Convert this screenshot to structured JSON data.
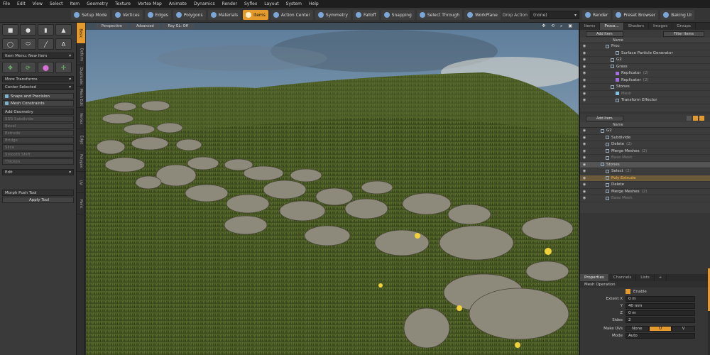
{
  "menu": [
    "File",
    "Edit",
    "View",
    "Select",
    "Item",
    "Geometry",
    "Texture",
    "Vertex Map",
    "Animate",
    "Dynamics",
    "Render",
    "Syflex",
    "Layout",
    "System",
    "Help"
  ],
  "modebar": {
    "buttons": [
      {
        "label": "Setup Mode",
        "icon": "setup-icon"
      },
      {
        "label": "Vertices",
        "icon": "vertices-icon"
      },
      {
        "label": "Edges",
        "icon": "edges-icon"
      },
      {
        "label": "Polygons",
        "icon": "polygons-icon"
      },
      {
        "label": "Materials",
        "icon": "materials-icon"
      },
      {
        "label": "Items",
        "icon": "items-icon",
        "active": true
      },
      {
        "label": "Action Center",
        "icon": "action-center-icon"
      },
      {
        "label": "Symmetry",
        "icon": "symmetry-icon"
      },
      {
        "label": "Falloff",
        "icon": "falloff-icon"
      },
      {
        "label": "Snapping",
        "icon": "snapping-icon"
      },
      {
        "label": "Select Through",
        "icon": "select-through-icon"
      },
      {
        "label": "WorkPlane",
        "icon": "workplane-icon"
      }
    ],
    "drop_action_label": "Drop Action",
    "drop_action_value": "(none)",
    "render_label": "Render",
    "preset_browser_label": "Preset Browser",
    "baking_label": "Baking UI"
  },
  "left": {
    "item_menu": "Item Menu: New Item",
    "more_transforms": "More Transforms",
    "center_selected": "Center Selected",
    "snaps": "Snaps and Precision",
    "mesh_constraints": "Mesh Constraints",
    "add_geometry": "Add Geometry",
    "geo_tools": [
      "SDS Subdivide",
      "Bevel",
      "Extrude",
      "Bridge",
      "Slice",
      "Smooth Shift",
      "Thicken"
    ],
    "edit_drop": "Edit",
    "morph_push": "Morph Push Tool",
    "apply_tool": "Apply Tool"
  },
  "side_tabs": [
    "Basic",
    "Deform",
    "Duplicate",
    "Mesh Edit",
    "Vertex",
    "Edge",
    "Polygon",
    "UV",
    "Paint"
  ],
  "viewport": {
    "tabs": [
      "Perspective",
      "Advanced",
      "Ray GL: Off"
    ],
    "tools": "✥ ⟲ ⌕ ▣"
  },
  "right": {
    "top_tabs": [
      "Items",
      "Proce...",
      "Shaders",
      "Images",
      "Groups"
    ],
    "add_item": "Add Item",
    "filter_items": "Filter Items",
    "name_header": "Name",
    "scene_items": [
      {
        "name": "Proc",
        "type": "folder",
        "indent": 2
      },
      {
        "name": "Surface Particle Generator",
        "type": "gen",
        "indent": 4
      },
      {
        "name": "G2",
        "type": "chk",
        "indent": 3
      },
      {
        "name": "Grass",
        "type": "chk",
        "indent": 3
      },
      {
        "name": "Replicator",
        "type": "rep",
        "count": "(2)",
        "indent": 4
      },
      {
        "name": "Replicator",
        "type": "rep",
        "count": "(2)",
        "indent": 4
      },
      {
        "name": "Stones",
        "type": "chk",
        "indent": 3
      },
      {
        "name": "Mesh",
        "type": "mesh",
        "indent": 4,
        "dim": true
      },
      {
        "name": "Transform Effector",
        "type": "gen",
        "indent": 4
      }
    ],
    "proc_add_item": "Add Item",
    "proc_items": [
      {
        "name": "G2",
        "indent": 1
      },
      {
        "name": "Subdivide",
        "indent": 2
      },
      {
        "name": "Delete",
        "count": "(2)",
        "indent": 2
      },
      {
        "name": "Merge Meshes",
        "count": "(2)",
        "indent": 2
      },
      {
        "name": "Base Mesh",
        "indent": 2,
        "dim": true
      },
      {
        "name": "Stones",
        "indent": 1,
        "selected": true
      },
      {
        "name": "Select",
        "count": "(2)",
        "indent": 2
      },
      {
        "name": "Poly Extrude",
        "indent": 2,
        "highlight": true
      },
      {
        "name": "Delete",
        "indent": 2
      },
      {
        "name": "Merge Meshes",
        "count": "(2)",
        "indent": 2
      },
      {
        "name": "Base Mesh",
        "indent": 2,
        "dim": true
      }
    ],
    "prop_tabs": [
      "Properties",
      "Channels",
      "Lists"
    ],
    "mesh_operation": "Mesh Operation",
    "enable_label": "Enable",
    "extent_label": "Extent X",
    "extent_x": "0 m",
    "extent_y": "40 mm",
    "extent_z": "0 m",
    "sides_label": "Sides",
    "sides": "2",
    "make_uvs_label": "Make UVs",
    "make_uvs_options": [
      "None",
      "U",
      "V"
    ],
    "mode_label": "Mode",
    "mode_value": "Auto"
  },
  "colors": {
    "accent": "#e49a2c",
    "panel": "#363636",
    "menubar": "#1e1e1e"
  }
}
